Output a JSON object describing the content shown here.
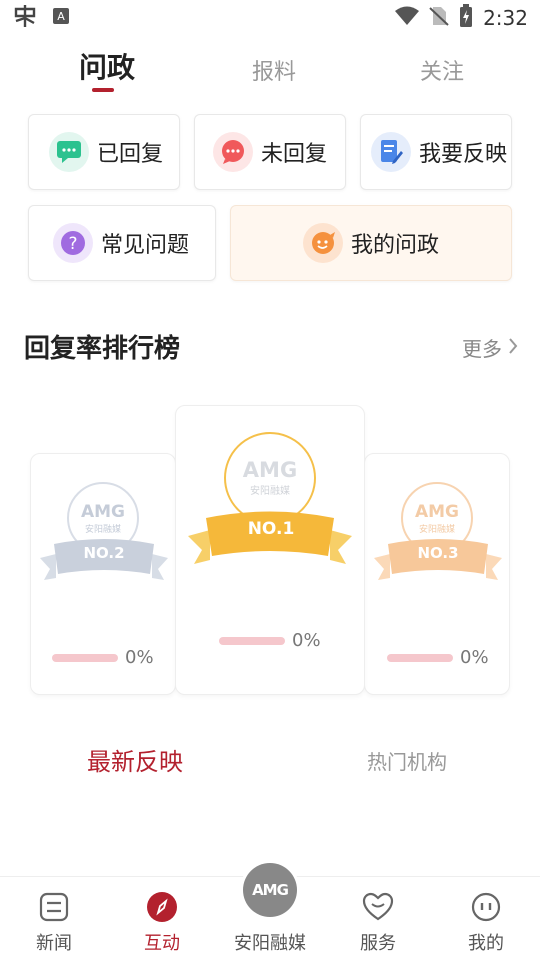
{
  "status_bar": {
    "time": "2:32"
  },
  "top_tabs": [
    {
      "label": "问政",
      "active": true
    },
    {
      "label": "报料",
      "active": false
    },
    {
      "label": "关注",
      "active": false
    }
  ],
  "quick_actions": {
    "replied": "已回复",
    "unreplied": "未回复",
    "feedback": "我要反映",
    "faq": "常见问题",
    "my_inquiry": "我的问政"
  },
  "ranking": {
    "title": "回复率排行榜",
    "more": "更多",
    "entries": [
      {
        "rank": "NO.2",
        "logo": "AMG",
        "logo_sub": "安阳融媒",
        "percent": "0%"
      },
      {
        "rank": "NO.1",
        "logo": "AMG",
        "logo_sub": "安阳融媒",
        "percent": "0%"
      },
      {
        "rank": "NO.3",
        "logo": "AMG",
        "logo_sub": "安阳融媒",
        "percent": "0%"
      }
    ]
  },
  "lower_tabs": [
    {
      "label": "最新反映",
      "active": true
    },
    {
      "label": "热门机构",
      "active": false
    }
  ],
  "bottom_nav": [
    {
      "label": "新闻",
      "active": false
    },
    {
      "label": "互动",
      "active": true
    },
    {
      "label": "安阳融媒",
      "active": false,
      "logo": "AMG"
    },
    {
      "label": "服务",
      "active": false
    },
    {
      "label": "我的",
      "active": false
    }
  ],
  "colors": {
    "accent": "#b3212e",
    "gold": "#f5b83a",
    "silver": "#c9d0dc",
    "bronze": "#f7c89a"
  }
}
